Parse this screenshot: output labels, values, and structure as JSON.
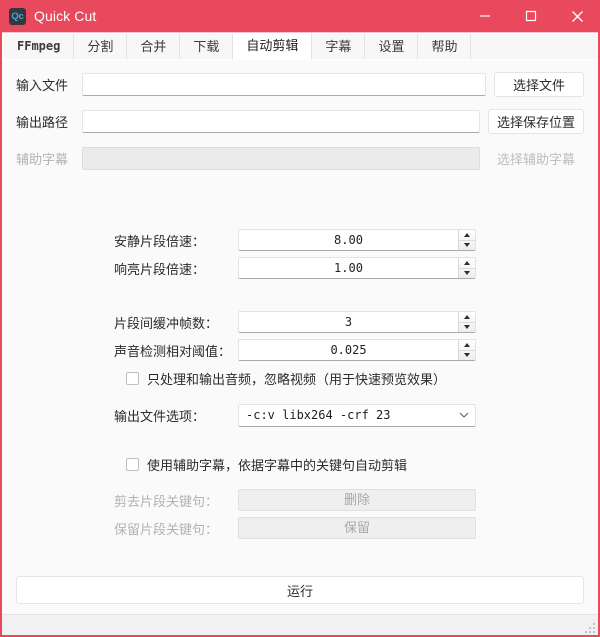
{
  "window": {
    "app_icon_text": "Qc",
    "title": "Quick Cut",
    "titlebar_color": "#e9495d",
    "controls": {
      "minimize": "minimize-icon",
      "maximize": "maximize-icon",
      "close": "close-icon"
    }
  },
  "tabs": [
    {
      "label": "FFmpeg",
      "active": false
    },
    {
      "label": "分割",
      "active": false
    },
    {
      "label": "合并",
      "active": false
    },
    {
      "label": "下载",
      "active": false
    },
    {
      "label": "自动剪辑",
      "active": true
    },
    {
      "label": "字幕",
      "active": false
    },
    {
      "label": "设置",
      "active": false
    },
    {
      "label": "帮助",
      "active": false
    }
  ],
  "file_rows": [
    {
      "label": "输入文件",
      "value": "",
      "placeholder": "",
      "button": "选择文件",
      "disabled": false
    },
    {
      "label": "输出路径",
      "value": "",
      "placeholder": "",
      "button": "选择保存位置",
      "disabled": false
    },
    {
      "label": "辅助字幕",
      "value": "",
      "placeholder": "",
      "button": "选择辅助字幕",
      "disabled": true
    }
  ],
  "speed_settings": [
    {
      "label": "安静片段倍速：",
      "value": "8.00"
    },
    {
      "label": "响亮片段倍速：",
      "value": "1.00"
    }
  ],
  "detect_settings": [
    {
      "label": "片段间缓冲帧数：",
      "value": "3"
    },
    {
      "label": "声音检测相对阈值：",
      "value": "0.025"
    }
  ],
  "audio_only_checkbox": {
    "label": "只处理和输出音频，忽略视频（用于快速预览效果）",
    "checked": false
  },
  "output_options": {
    "label": "输出文件选项：",
    "value": "-c:v libx264 -crf 23"
  },
  "subtitle_checkbox": {
    "label": "使用辅助字幕，依据字幕中的关键句自动剪辑",
    "checked": false
  },
  "keyword_rows": [
    {
      "label": "剪去片段关键句：",
      "value": "删除",
      "disabled": true
    },
    {
      "label": "保留片段关键句：",
      "value": "保留",
      "disabled": true
    }
  ],
  "run_button": {
    "label": "运行"
  },
  "statusbar": {
    "text": ""
  }
}
